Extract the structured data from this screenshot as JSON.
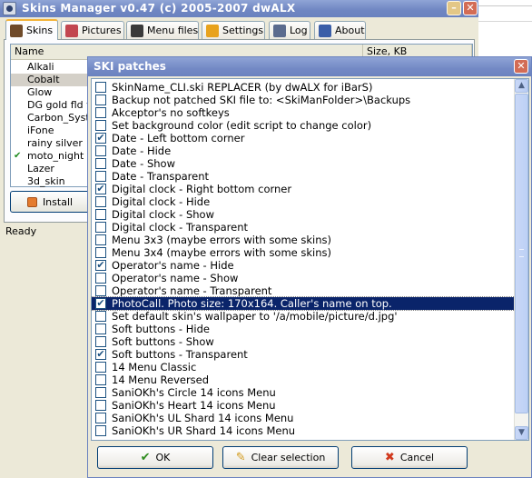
{
  "main_window": {
    "title": "Skins Manager v0.47 (c) 2005-2007 dwALX",
    "minimize_glyph": "–",
    "close_glyph": "✕",
    "tabs": [
      {
        "label": "Skins",
        "icon": "skins-icon",
        "icon_color": "#6f4a2a"
      },
      {
        "label": "Pictures",
        "icon": "pictures-icon",
        "icon_color": "#c2464f"
      },
      {
        "label": "Menu files",
        "icon": "menu-files-icon",
        "icon_color": "#3a3a3a"
      },
      {
        "label": "Settings",
        "icon": "settings-icon",
        "icon_color": "#e8a21c"
      },
      {
        "label": "Log",
        "icon": "log-icon",
        "icon_color": "#5b6b8e"
      },
      {
        "label": "About",
        "icon": "about-icon",
        "icon_color": "#3b5ea8"
      }
    ],
    "columns": {
      "name": "Name",
      "size": "Size, KB"
    },
    "skins": [
      {
        "name": "Alkali",
        "checked": false,
        "selected": false
      },
      {
        "name": "Cobalt",
        "checked": false,
        "selected": true
      },
      {
        "name": "Glow",
        "checked": false,
        "selected": false
      },
      {
        "name": "DG gold fld ver",
        "checked": false,
        "selected": false
      },
      {
        "name": "Carbon_System",
        "checked": false,
        "selected": false
      },
      {
        "name": "iFone",
        "checked": false,
        "selected": false
      },
      {
        "name": "rainy silver",
        "checked": false,
        "selected": false
      },
      {
        "name": "moto_night",
        "checked": true,
        "selected": false
      },
      {
        "name": "Lazer",
        "checked": false,
        "selected": false
      },
      {
        "name": "3d_skin",
        "checked": false,
        "selected": false
      }
    ],
    "install_label": "Install",
    "status": "Ready"
  },
  "dialog": {
    "title": "SKI patches",
    "close_glyph": "✕",
    "patches": [
      {
        "label": "SkinName_CLI.ski REPLACER (by dwALX for iBarS)",
        "checked": false,
        "selected": false
      },
      {
        "label": "Backup not patched SKI file to: <SkiManFolder>\\Backups",
        "checked": false,
        "selected": false
      },
      {
        "label": "Akceptor's no softkeys",
        "checked": false,
        "selected": false
      },
      {
        "label": "Set background color (edit script to change color)",
        "checked": false,
        "selected": false
      },
      {
        "label": "Date - Left bottom corner",
        "checked": true,
        "selected": false
      },
      {
        "label": "Date - Hide",
        "checked": false,
        "selected": false
      },
      {
        "label": "Date - Show",
        "checked": false,
        "selected": false
      },
      {
        "label": "Date - Transparent",
        "checked": false,
        "selected": false
      },
      {
        "label": "Digital clock - Right bottom corner",
        "checked": true,
        "selected": false
      },
      {
        "label": "Digital clock - Hide",
        "checked": false,
        "selected": false
      },
      {
        "label": "Digital clock - Show",
        "checked": false,
        "selected": false
      },
      {
        "label": "Digital clock - Transparent",
        "checked": false,
        "selected": false
      },
      {
        "label": "Menu 3x3 (maybe errors with some skins)",
        "checked": false,
        "selected": false
      },
      {
        "label": "Menu 3x4 (maybe errors with some skins)",
        "checked": false,
        "selected": false
      },
      {
        "label": "Operator's name - Hide",
        "checked": true,
        "selected": false
      },
      {
        "label": "Operator's name - Show",
        "checked": false,
        "selected": false
      },
      {
        "label": "Operator's name - Transparent",
        "checked": false,
        "selected": false
      },
      {
        "label": "PhotoCall. Photo size: 170x164. Caller's name on top.",
        "checked": true,
        "selected": true
      },
      {
        "label": "Set default skin's wallpaper to '/a/mobile/picture/d.jpg'",
        "checked": false,
        "selected": false
      },
      {
        "label": "Soft buttons - Hide",
        "checked": false,
        "selected": false
      },
      {
        "label": "Soft buttons - Show",
        "checked": false,
        "selected": false
      },
      {
        "label": "Soft buttons - Transparent",
        "checked": true,
        "selected": false
      },
      {
        "label": "14 Menu Classic",
        "checked": false,
        "selected": false
      },
      {
        "label": "14 Menu Reversed",
        "checked": false,
        "selected": false
      },
      {
        "label": "SaniOKh's Circle 14 icons Menu",
        "checked": false,
        "selected": false
      },
      {
        "label": "SaniOKh's Heart 14 icons Menu",
        "checked": false,
        "selected": false
      },
      {
        "label": "SaniOKh's UL Shard 14 icons Menu",
        "checked": false,
        "selected": false
      },
      {
        "label": "SaniOKh's UR Shard 14 icons Menu",
        "checked": false,
        "selected": false
      }
    ],
    "scroll_up_glyph": "▲",
    "scroll_down_glyph": "▼",
    "buttons": {
      "ok": {
        "label": "OK",
        "icon": "checkmark-icon",
        "icon_glyph": "✔",
        "icon_color": "#2e8b1e"
      },
      "clear": {
        "label": "Clear selection",
        "icon": "eraser-icon",
        "icon_glyph": "✎",
        "icon_color": "#d39a1a"
      },
      "cancel": {
        "label": "Cancel",
        "icon": "cancel-x-icon",
        "icon_glyph": "✖",
        "icon_color": "#d1391d"
      }
    }
  },
  "colors": {
    "titlebar": "#7389c5",
    "selection": "#0a246a",
    "checkmark": "#1c5180"
  }
}
